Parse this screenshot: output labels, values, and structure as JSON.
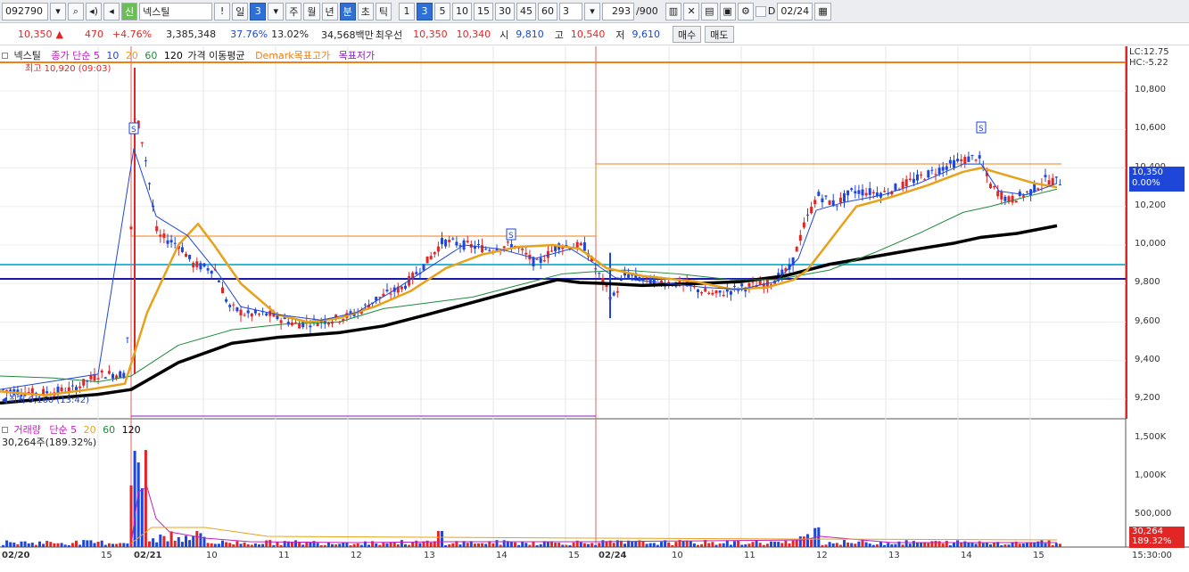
{
  "toolbar": {
    "code": "092790",
    "shin": "신",
    "name": "넥스틸",
    "warn": "!",
    "period_day": "일",
    "period_num": "3",
    "week": "주",
    "month": "월",
    "year": "년",
    "minute": "분",
    "second": "초",
    "tick": "틱",
    "intervals": [
      "1",
      "3",
      "5",
      "10",
      "15",
      "30",
      "45",
      "60"
    ],
    "interval_value": "3",
    "count": "293",
    "count_max": "/900",
    "date": "02/24",
    "date_check": "D"
  },
  "quote": {
    "price": "10,350",
    "change": "470",
    "change_pct": "+4.76%",
    "volume": "3,385,348",
    "vol_ratio": "37.76%",
    "turnover": "13.02%",
    "amount": "34,568백만",
    "best_ask_label": "최우선",
    "ask": "10,350",
    "bid": "10,340",
    "open_label": "시",
    "open": "9,810",
    "high_label": "고",
    "high": "10,540",
    "low_label": "저",
    "low": "9,610",
    "buy_label": "매수",
    "sell_label": "매도"
  },
  "price_legend": {
    "name": "넥스틸",
    "ma_label": "종가 단순 5",
    "ma10": "10",
    "ma20": "20",
    "ma60": "60",
    "ma120": "120",
    "price_ma": "가격 이동평균",
    "demark_high": "Demark목표고가",
    "demark_low": "목표저가",
    "max_label": "최고 10,920 (09:03)",
    "min_label": "최저 9,160 (13:42)",
    "lc": "LC:12.75",
    "hc": "HC:-5.22",
    "last_price": "10,350",
    "last_pct": "0.00%"
  },
  "volume_legend": {
    "name": "거래량",
    "ma_label": "단순 5",
    "ma20": "20",
    "ma60": "60",
    "ma120": "120",
    "value": "30,264주(189.32%)",
    "last_vol": "30,264",
    "last_pct": "189.32%"
  },
  "price_axis": [
    "10,800",
    "10,600",
    "10,400",
    "10,200",
    "10,000",
    "9,800",
    "9,600",
    "9,400",
    "9,200"
  ],
  "volume_axis": [
    "1,500K",
    "1,000K",
    "500,000"
  ],
  "time_axis": [
    "02/20",
    "15",
    "02/21",
    "10",
    "11",
    "12",
    "13",
    "14",
    "15",
    "02/24",
    "10",
    "11",
    "12",
    "13",
    "14",
    "15",
    "15:30:00"
  ],
  "colors": {
    "up": "#e22626",
    "down": "#1e46d8",
    "ma5": "#c020c0",
    "ma20": "#e8a21a",
    "ma60": "#1f8a3a",
    "ma120": "#000000",
    "demark": "#f07f1a"
  }
}
